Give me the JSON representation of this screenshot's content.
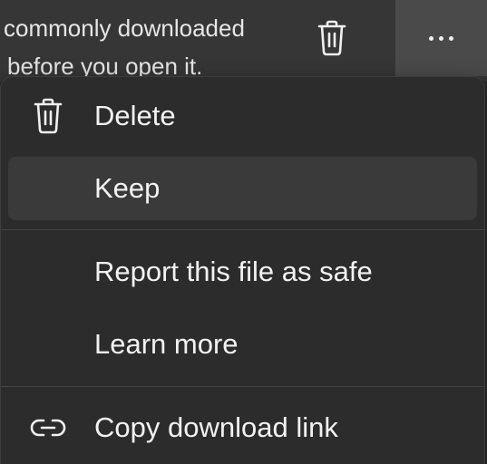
{
  "download_item": {
    "warning_line1": "commonly downloaded",
    "warning_line2": "before you open it.",
    "delete_icon": "trash-icon",
    "more_icon": "more-dots-icon"
  },
  "menu": {
    "items": [
      {
        "label": "Delete",
        "icon": "trash-icon"
      },
      {
        "label": "Keep",
        "icon": "",
        "selected": true
      },
      {
        "label": "Report this file as safe",
        "icon": ""
      },
      {
        "label": "Learn more",
        "icon": ""
      },
      {
        "label": "Copy download link",
        "icon": "link-icon"
      }
    ]
  },
  "colors": {
    "menu_background": "#2c2c2c",
    "selected_item_background": "#3a3a3a",
    "text": "#f2f2f2"
  }
}
